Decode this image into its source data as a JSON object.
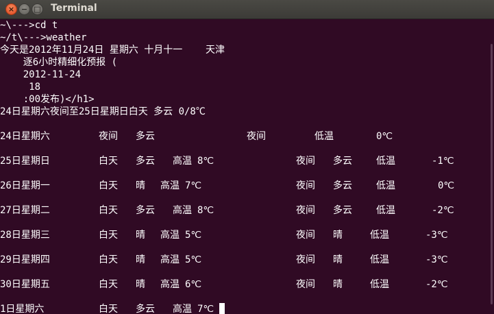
{
  "window": {
    "title": "Terminal",
    "close_glyph": "×",
    "minimize_glyph": "−",
    "maximize_glyph": "□"
  },
  "terminal": {
    "lines": [
      "~\\--->cd t",
      "~/t\\--->weather",
      "今天是2012年11月24日 星期六 十月十一    天津",
      "    逐6小时精细化预报 (",
      "    2012-11-24",
      "     18",
      "    :00发布)</h1>",
      "24日星期六夜间至25日星期日白天 多云 0/8℃"
    ],
    "forecast": [
      {
        "date": "24日星期六",
        "day": "夜间",
        "day_weather": "多云",
        "day_temp_label": "",
        "day_temp": "",
        "night": "夜间",
        "night_weather": "",
        "night_temp_label": "低温",
        "night_temp": "0℃"
      },
      {
        "date": "25日星期日",
        "day": "白天",
        "day_weather": "多云",
        "day_temp_label": "高温",
        "day_temp": "8℃",
        "night": "夜间",
        "night_weather": "多云",
        "night_temp_label": "低温",
        "night_temp": "-1℃"
      },
      {
        "date": "26日星期一",
        "day": "白天",
        "day_weather": "晴",
        "day_temp_label": "高温",
        "day_temp": "7℃",
        "night": "夜间",
        "night_weather": "多云",
        "night_temp_label": "低温",
        "night_temp": "0℃"
      },
      {
        "date": "27日星期二",
        "day": "白天",
        "day_weather": "多云",
        "day_temp_label": "高温",
        "day_temp": "8℃",
        "night": "夜间",
        "night_weather": "多云",
        "night_temp_label": "低温",
        "night_temp": "-2℃"
      },
      {
        "date": "28日星期三",
        "day": "白天",
        "day_weather": "晴",
        "day_temp_label": "高温",
        "day_temp": "5℃",
        "night": "夜间",
        "night_weather": "晴",
        "night_temp_label": "低温",
        "night_temp": "-3℃"
      },
      {
        "date": "29日星期四",
        "day": "白天",
        "day_weather": "晴",
        "day_temp_label": "高温",
        "day_temp": "5℃",
        "night": "夜间",
        "night_weather": "晴",
        "night_temp_label": "低温",
        "night_temp": "-3℃"
      },
      {
        "date": "30日星期五",
        "day": "白天",
        "day_weather": "晴",
        "day_temp_label": "高温",
        "day_temp": "6℃",
        "night": "夜间",
        "night_weather": "晴",
        "night_temp_label": "低温",
        "night_temp": "-2℃"
      },
      {
        "date": "1日星期六",
        "day": "白天",
        "day_weather": "多云",
        "day_temp_label": "高温",
        "day_temp": "7℃",
        "night": "",
        "night_weather": "",
        "night_temp_label": "",
        "night_temp": ""
      }
    ]
  },
  "colors": {
    "background": "#300a24",
    "text": "#ffffff",
    "titlebar": "#3c3b37",
    "close_button": "#e0461f"
  }
}
